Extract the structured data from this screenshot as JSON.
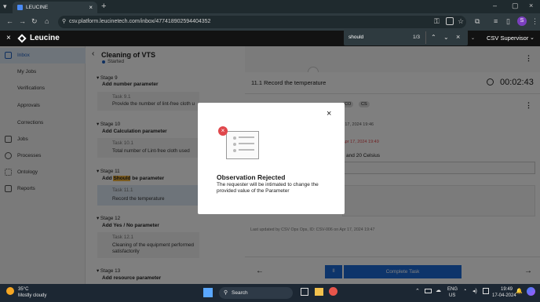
{
  "browser": {
    "tab_title": "LEUCINE",
    "url": "csv.platform.leucinetech.com/inbox/477418902594404352",
    "find": {
      "query": "should",
      "count": "1/3"
    },
    "profile_initial": "S"
  },
  "app": {
    "brand": "Leucine",
    "user_role": "CSV Supervisor",
    "page_title": "Cleaning of VTS",
    "page_status": "Started"
  },
  "sidebar": {
    "items": [
      {
        "label": "Inbox",
        "icon": "inbox-icon"
      },
      {
        "label": "My Jobs",
        "icon": ""
      },
      {
        "label": "Verifications",
        "icon": ""
      },
      {
        "label": "Approvals",
        "icon": ""
      },
      {
        "label": "Corrections",
        "icon": ""
      },
      {
        "label": "Jobs",
        "icon": "jobs-icon"
      },
      {
        "label": "Processes",
        "icon": "processes-icon"
      },
      {
        "label": "Ontology",
        "icon": "ontology-icon"
      },
      {
        "label": "Reports",
        "icon": "reports-icon"
      }
    ]
  },
  "stages": [
    {
      "title": "Stage 9",
      "name": "Add number parameter",
      "task_no": "Task 9.1",
      "task_name": "Provide the number of lint-free cloth u"
    },
    {
      "title": "Stage 10",
      "name": "Add Calculation parameter",
      "task_no": "Task 10.1",
      "task_name": "Total number of Lint-free cloth used"
    },
    {
      "title": "Stage 11",
      "name_before": "Add ",
      "name_highlight": "Should",
      "name_after": " be parameter",
      "task_no": "Task 11.1",
      "task_name": "Record the temperature"
    },
    {
      "title": "Stage 12",
      "name": "Add Yes / No parameter",
      "task_no": "Task 12.1",
      "task_name": "Cleaning of the equipment performed satisfactorily"
    },
    {
      "title": "Stage 13",
      "name": "Add resource parameter"
    }
  ],
  "task_panel": {
    "title": "11.1 Record the temperature",
    "timer": "00:02:43",
    "badges": [
      "CO",
      "CS"
    ],
    "ts1": "r 17, 2024 19:46",
    "ts2": "Apr 17, 2024 19:49",
    "value_text": "s and 20 Celsius",
    "last_updated": "Last updated by CSV Ops Ops, ID: CSV-006 on Apr 17, 2024 19:47",
    "complete_label": "Complete Task",
    "pause_label": "II"
  },
  "modal": {
    "title": "Observation Rejected",
    "body": "The requester will be intimated to change the provided value of the Parameter"
  },
  "taskbar": {
    "weather_temp": "35°C",
    "weather_desc": "Mostly cloudy",
    "search_placeholder": "Search",
    "lang1": "ENG",
    "lang2": "US",
    "time": "19:49",
    "date": "17-04-2024"
  },
  "colors": {
    "brand_blue": "#1d5fbf",
    "button_blue": "#1d6bd6",
    "error_red": "#e0474c",
    "highlight": "#f6b73c"
  }
}
